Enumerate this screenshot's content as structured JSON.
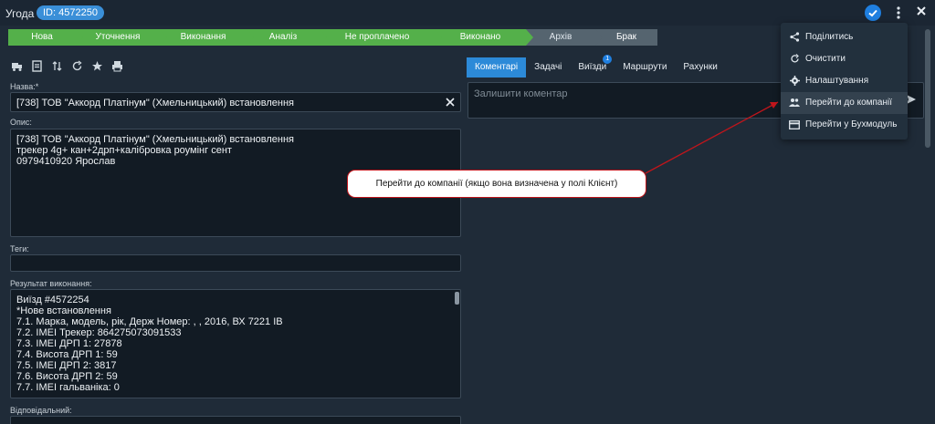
{
  "header": {
    "title": "Угода",
    "id_badge": "ID: 4572250"
  },
  "pipeline": [
    "Нова",
    "Уточнення",
    "Виконання",
    "Аналіз",
    "Не проплачено",
    "Виконано",
    "Архів",
    "Брак"
  ],
  "form": {
    "name_label": "Назва:*",
    "name_value": "[738] ТОВ \"Аккорд Платінум\" (Хмельницький) встановлення",
    "desc_label": "Опис:",
    "desc_value": "[738] ТОВ \"Аккорд Платінум\" (Хмельницький) встановлення\nтрекер 4g+ кан+2дрп+калібровка роумінг сент\n0979410920 Ярослав",
    "tags_label": "Теги:",
    "result_label": "Результат виконання:",
    "result_value": "Виїзд #4572254\n*Нове встановлення\n7.1. Марка, модель, рік, Держ Номер: , , 2016, ВХ 7221 ІВ\n7.2. IMEI Трекер: 864275073091533\n7.3. IMEI ДРП 1: 27878\n7.4. Висота ДРП 1: 59\n7.5. IMEI ДРП 2: 3817\n7.6. Висота ДРП 2: 59\n7.7. IMEI гальваніка: 0",
    "responsible_label": "Відповідальний:"
  },
  "tabs": [
    {
      "label": "Коментарі"
    },
    {
      "label": "Задачі"
    },
    {
      "label": "Виїзди",
      "badge": "1"
    },
    {
      "label": "Маршрути"
    },
    {
      "label": "Рахунки"
    }
  ],
  "comment": {
    "placeholder": "Залишити коментар"
  },
  "menu": [
    {
      "label": "Поділитись",
      "icon": "share-icon"
    },
    {
      "label": "Очистити",
      "icon": "refresh-icon"
    },
    {
      "label": "Налаштування",
      "icon": "gear-icon"
    },
    {
      "label": "Перейти до компанії",
      "icon": "users-icon"
    },
    {
      "label": "Перейти у Бухмодуль",
      "icon": "card-icon"
    }
  ],
  "callout": {
    "text": "Перейти до компанії (якщо вона визначена у полі Клієнт)"
  },
  "colors": {
    "stage_done": "#54b04a",
    "stage_todo": "#55646f",
    "accent": "#2c8ad8",
    "callout_border": "#c0151b"
  }
}
